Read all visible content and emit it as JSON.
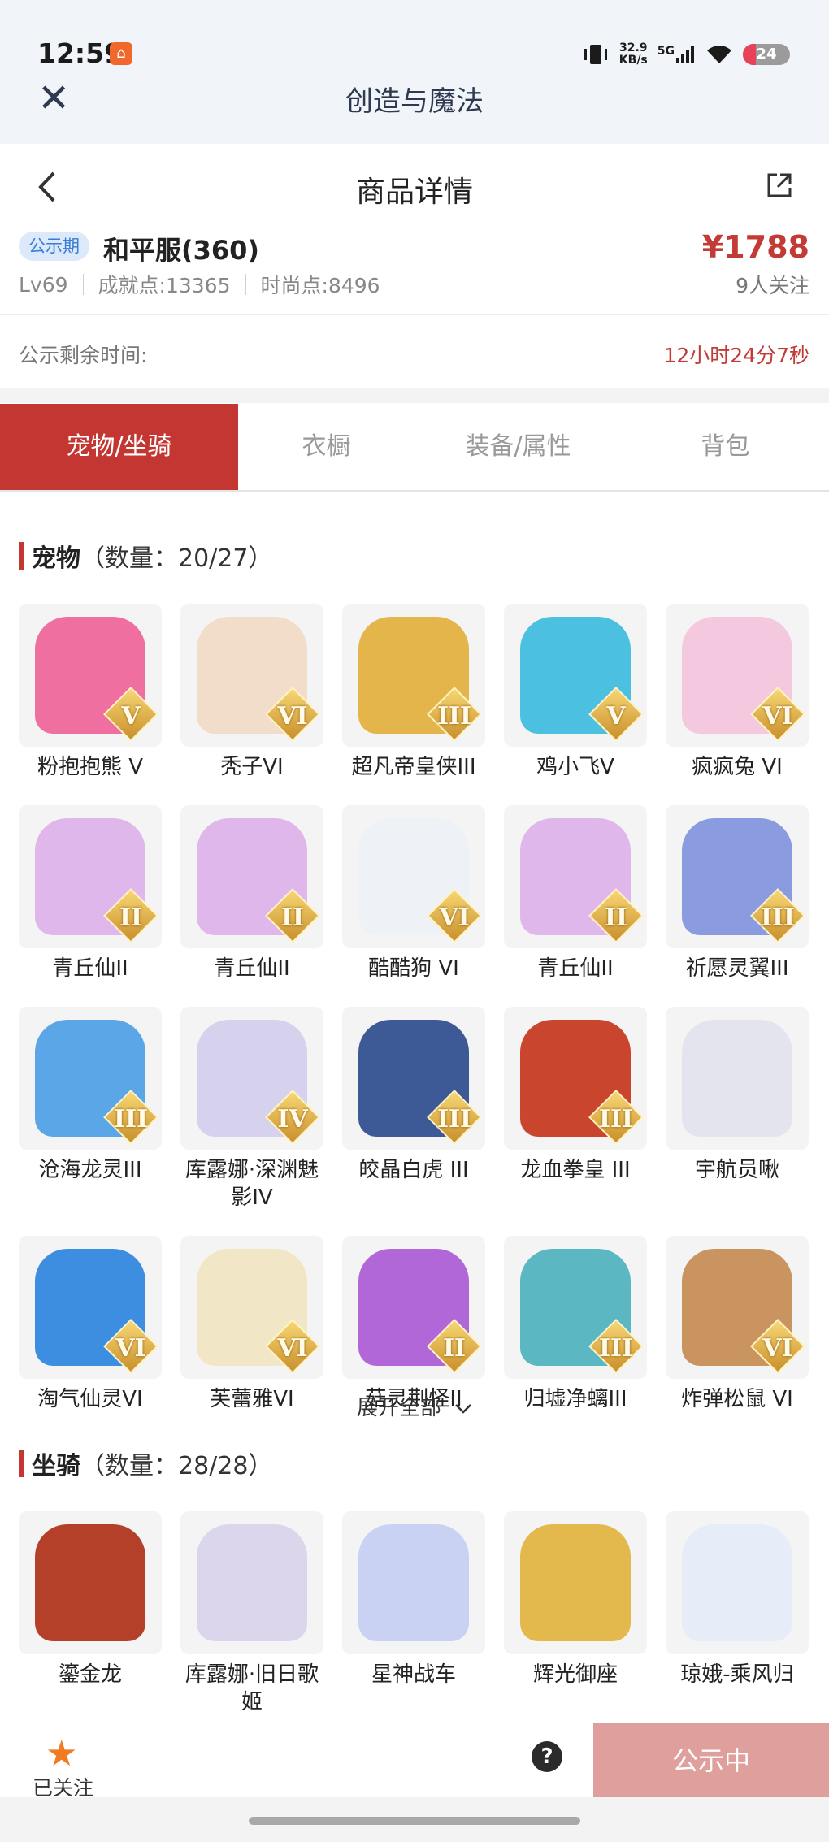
{
  "status": {
    "time": "12:59",
    "speed": "32.9\nKB/s",
    "network": "5G",
    "battery": "24"
  },
  "appbar": {
    "title": "创造与魔法"
  },
  "nav": {
    "title": "商品详情"
  },
  "listing": {
    "badge": "公示期",
    "server": "和平服(360)",
    "price": "¥1788",
    "level": "Lv69",
    "achievement": "成就点:13365",
    "fashion": "时尚点:8496",
    "followers": "9人关注",
    "timer_label": "公示剩余时间:",
    "timer_value": "12小时24分7秒"
  },
  "tabs": [
    "宠物/坐骑",
    "衣橱",
    "装备/属性",
    "背包"
  ],
  "pets": {
    "title": "宠物",
    "count": "（数量：20/27）",
    "items": [
      {
        "name": "粉抱抱熊 V",
        "grade": "V",
        "color": "#ee6fa0"
      },
      {
        "name": "秃子VI",
        "grade": "VI",
        "color": "#f1ddc9"
      },
      {
        "name": "超凡帝皇侠III",
        "grade": "III",
        "color": "#e3b54a"
      },
      {
        "name": "鸡小飞V",
        "grade": "V",
        "color": "#4cc0e0"
      },
      {
        "name": "疯疯兔 VI",
        "grade": "VI",
        "color": "#f4c8de"
      },
      {
        "name": "青丘仙II",
        "grade": "II",
        "color": "#e0b7ea"
      },
      {
        "name": "青丘仙II",
        "grade": "II",
        "color": "#e0b7ea"
      },
      {
        "name": "酷酷狗 VI",
        "grade": "VI",
        "color": "#eef2f6"
      },
      {
        "name": "青丘仙II",
        "grade": "II",
        "color": "#e0b7ea"
      },
      {
        "name": "祈愿灵翼III",
        "grade": "III",
        "color": "#8a9be0"
      },
      {
        "name": "沧海龙灵III",
        "grade": "III",
        "color": "#5aa6e6"
      },
      {
        "name": "库露娜·深渊魅影IV",
        "grade": "IV",
        "color": "#d6d2ee"
      },
      {
        "name": "皎晶白虎 III",
        "grade": "III",
        "color": "#3e5a96"
      },
      {
        "name": "龙血拳皇 III",
        "grade": "III",
        "color": "#c9452e"
      },
      {
        "name": "宇航员啾",
        "grade": "",
        "color": "#e4e4ee"
      },
      {
        "name": "淘气仙灵VI",
        "grade": "VI",
        "color": "#3d8ee0"
      },
      {
        "name": "芙蕾雅VI",
        "grade": "VI",
        "color": "#f1e6c6"
      },
      {
        "name": "菇灵荆怪II",
        "grade": "II",
        "color": "#b167d8"
      },
      {
        "name": "归墟净螭III",
        "grade": "III",
        "color": "#5bb7c1"
      },
      {
        "name": "炸弹松鼠 VI",
        "grade": "VI",
        "color": "#c99460"
      }
    ]
  },
  "expand_label": "展开全部",
  "mounts": {
    "title": "坐骑",
    "count": "（数量：28/28）",
    "items": [
      {
        "name": "鎏金龙",
        "grade": "",
        "color": "#b5402a"
      },
      {
        "name": "库露娜·旧日歌姬",
        "grade": "",
        "color": "#dcd6ec"
      },
      {
        "name": "星神战车",
        "grade": "",
        "color": "#c9d2f2"
      },
      {
        "name": "辉光御座",
        "grade": "",
        "color": "#e3b94e"
      },
      {
        "name": "琼娥-乘风归",
        "grade": "",
        "color": "#e6ecf8"
      }
    ]
  },
  "bottom": {
    "fav_label": "已关注",
    "help": "?",
    "cta": "公示中"
  }
}
